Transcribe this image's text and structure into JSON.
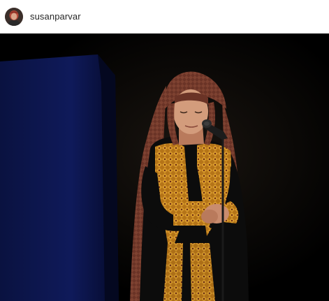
{
  "post": {
    "username": "susanparvar",
    "avatar_icon": "profile-avatar",
    "colors": {
      "stage_background": "#000000",
      "curtain_blue": "#0d1650",
      "headscarf": "#6a3326",
      "embroidery_gold": "#c98a22",
      "dress_black": "#0c0c0c"
    }
  }
}
